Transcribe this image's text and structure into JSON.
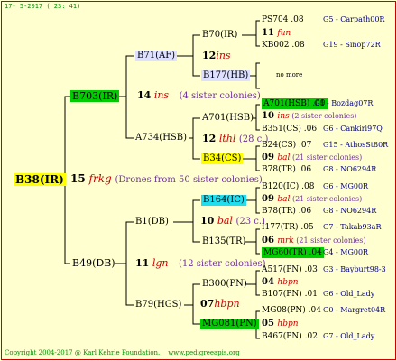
{
  "header": "17-  5-2017 ( 23: 41)",
  "footer": {
    "copyright": "Copyright 2004-2017 @ Karl Kehrle Foundation.",
    "url": "www.pedigreeapis.org"
  },
  "colors": {
    "green": "#00cc00",
    "yellow": "#ffff00",
    "cyan": "#22ddee",
    "lavender": "#dde0ff",
    "navy": "#000080",
    "purple": "#7030a0",
    "red": "#cc0000"
  },
  "root": {
    "label": "B38(IR)",
    "gen": "15",
    "line": "frkg",
    "note": "(Drones from 50 sister colonies)"
  },
  "g1": {
    "upper": {
      "label": "B703(IR)",
      "gen": "14",
      "line": "ins",
      "note": "(4 sister colonies)"
    },
    "lower": {
      "label": "B49(DB)",
      "gen": "11",
      "line": "lgn",
      "note": "(12 sister colonies)"
    }
  },
  "g2": {
    "b71": "B71(AF)",
    "a734": "A734(HSB)",
    "b1": "B1(DB)",
    "b79": "B79(HGS)"
  },
  "g3": {
    "b70": {
      "label": "B70(IR)",
      "gen": "12",
      "line": "ins"
    },
    "b177": {
      "label": "B177(HB)"
    },
    "a701": {
      "label": "A701(HSB)",
      "gen": "12",
      "line": "lthl",
      "note": "(28 c.)"
    },
    "b34": {
      "label": "B34(CS)"
    },
    "b164": {
      "label": "B164(IC)",
      "gen": "10",
      "line": "bal",
      "note": "(23 c.)"
    },
    "b135": {
      "label": "B135(TR)"
    },
    "b300": {
      "label": "B300(PN)",
      "gen": "07",
      "line": "hbpn"
    },
    "mg081": {
      "label": "MG081(PN)"
    }
  },
  "no_more": "no more",
  "leaves": [
    {
      "label": "PS704",
      "num": ".08",
      "src": "G5 - Carpath00R"
    },
    {
      "gen": "11",
      "line": "fun"
    },
    {
      "label": "KB002",
      "num": ".08",
      "src": "G19 - Sinop72R"
    },
    {
      "label": "A701(HSB)",
      "num": ".09",
      "src": "G4 - Bozdag07R"
    },
    {
      "gen": "10",
      "line": "ins",
      "note": "(2 sister colonies)"
    },
    {
      "label": "B351(CS)",
      "num": ".06",
      "src": "G6 - Cankiri97Q"
    },
    {
      "label": "B24(CS)",
      "num": ".07",
      "src": "G15 - AthosSt80R"
    },
    {
      "gen": "09",
      "line": "bal",
      "note": "(21 sister colonies)"
    },
    {
      "label": "B78(TR)",
      "num": ".06",
      "src": "G8 - NO6294R"
    },
    {
      "label": "B120(IC)",
      "num": ".08",
      "src": "G6 - MG00R"
    },
    {
      "gen": "09",
      "line": "bal",
      "note": "(21 sister colonies)"
    },
    {
      "label": "B78(TR)",
      "num": ".06",
      "src": "G8 - NO6294R"
    },
    {
      "label": "I177(TR)",
      "num": ".05",
      "src": "G7 - Takab93aR"
    },
    {
      "gen": "06",
      "line": "mrk",
      "note": "(21 sister colonies)"
    },
    {
      "label": "MG60(TR)",
      "num": ".04",
      "src": "G4 - MG00R"
    },
    {
      "label": "A517(PN)",
      "num": ".03",
      "src": "G3 - Bayburt98-3"
    },
    {
      "gen": "04",
      "line": "hbpn"
    },
    {
      "label": "B107(PN)",
      "num": ".01",
      "src": "G6 - Old_Lady"
    },
    {
      "label": "MG08(PN)",
      "num": ".04",
      "src": "G0 - Margret04R"
    },
    {
      "gen": "05",
      "line": "hbpn"
    },
    {
      "label": "B467(PN)",
      "num": ".02",
      "src": "G7 - Old_Lady"
    }
  ]
}
